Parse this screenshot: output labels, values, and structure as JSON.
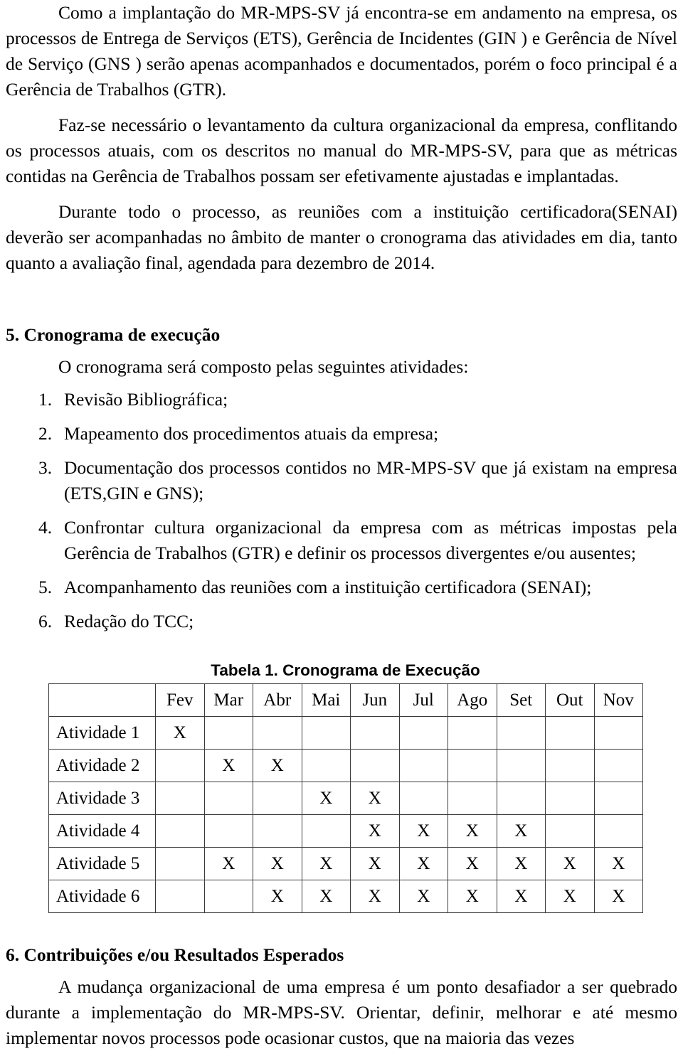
{
  "document": {
    "paragraphs": [
      {
        "id": "p-implantacao",
        "text": "Como a implantação do MR-MPS-SV já encontra-se em andamento na empresa, os processos de Entrega de Serviços (ETS), Gerência de Incidentes (GIN ) e Gerência de Nível de Serviço (GNS ) serão apenas acompanhados e documentados, porém o foco principal é a Gerência de Trabalhos (GTR)."
      },
      {
        "id": "p-levantamento",
        "text": "Faz-se necessário o levantamento da cultura organizacional da empresa, conflitando os processos atuais, com os descritos no manual do MR-MPS-SV, para que as métricas contidas na Gerência de Trabalhos possam ser efetivamente ajustadas e implantadas."
      },
      {
        "id": "p-reunioes",
        "text": "Durante todo o processo, as reuniões com a instituição certificadora(SENAI) deverão ser acompanhadas no âmbito de manter o cronograma das atividades em dia, tanto quanto a avaliação final, agendada para dezembro de 2014."
      }
    ],
    "section_cronograma": {
      "heading": "5. Cronograma de execução",
      "intro": "O cronograma será composto pelas seguintes atividades:",
      "items": [
        {
          "num": "1.",
          "text": "Revisão Bibliográfica;"
        },
        {
          "num": "2.",
          "text": "Mapeamento dos procedimentos atuais da empresa;"
        },
        {
          "num": "3.",
          "text": "Documentação dos processos contidos no MR-MPS-SV que já existam na empresa (ETS,GIN e GNS);"
        },
        {
          "num": "4.",
          "text": "Confrontar cultura organizacional da empresa com as métricas impostas pela Gerência de Trabalhos (GTR) e definir os processos divergentes e/ou ausentes;"
        },
        {
          "num": "5.",
          "text": "Acompanhamento das reuniões com a instituição certificadora (SENAI);"
        },
        {
          "num": "6.",
          "text": "Redação do TCC;"
        }
      ]
    },
    "section_contribuicoes": {
      "heading": "6. Contribuições e/ou Resultados Esperados",
      "paragraph": "A mudança organizacional  de uma empresa é um ponto desafiador a ser quebrado durante a implementação do MR-MPS-SV. Orientar, definir, melhorar e até mesmo implementar novos processos pode ocasionar custos, que na maioria das vezes"
    }
  },
  "chart_data": {
    "type": "table",
    "title": "Tabela 1. Cronograma de Execução",
    "corner_label": "",
    "categories": [
      "Fev",
      "Mar",
      "Abr",
      "Mai",
      "Jun",
      "Jul",
      "Ago",
      "Set",
      "Out",
      "Nov"
    ],
    "mark": "X",
    "rows": [
      {
        "label": "Atividade 1",
        "cells": [
          "X",
          "",
          "",
          "",
          "",
          "",
          "",
          "",
          "",
          ""
        ]
      },
      {
        "label": "Atividade 2",
        "cells": [
          "",
          "X",
          "X",
          "",
          "",
          "",
          "",
          "",
          "",
          ""
        ]
      },
      {
        "label": "Atividade 3",
        "cells": [
          "",
          "",
          "",
          "X",
          "X",
          "",
          "",
          "",
          "",
          ""
        ]
      },
      {
        "label": "Atividade 4",
        "cells": [
          "",
          "",
          "",
          "",
          "X",
          "X",
          "X",
          "X",
          "",
          ""
        ]
      },
      {
        "label": "Atividade 5",
        "cells": [
          "",
          "X",
          "X",
          "X",
          "X",
          "X",
          "X",
          "X",
          "X",
          "X"
        ]
      },
      {
        "label": "Atividade 6",
        "cells": [
          "",
          "",
          "X",
          "X",
          "X",
          "X",
          "X",
          "X",
          "X",
          "X"
        ]
      }
    ]
  }
}
